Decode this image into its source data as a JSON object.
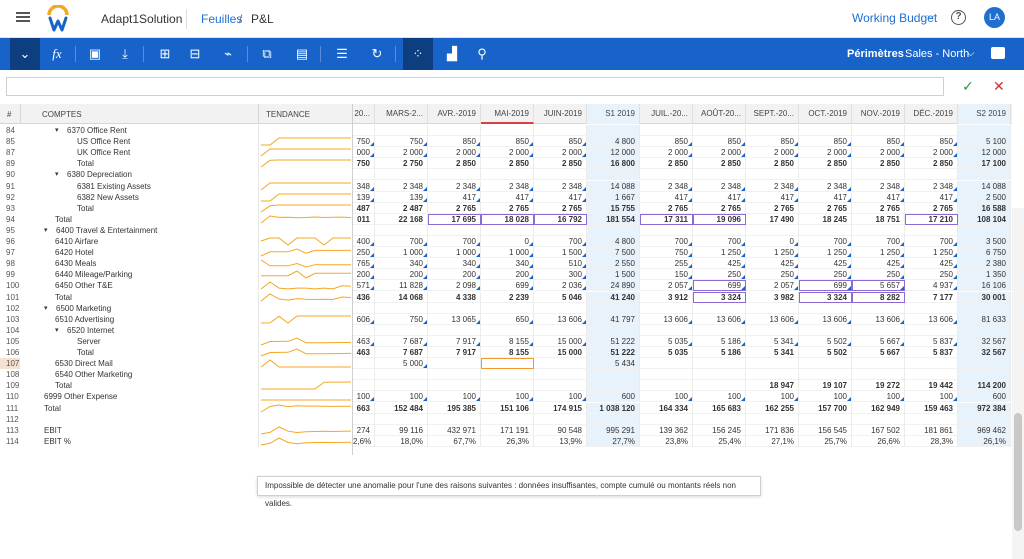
{
  "header": {
    "app_name": "Adapt1Solution",
    "breadcrumb": [
      "Feuilles",
      "/",
      "P&L"
    ],
    "working_budget": "Working Budget",
    "avatar_initials": "LA",
    "help": "?"
  },
  "toolbar": {
    "perimetres_label": "Périmètres",
    "sales_label": "Sales - North",
    "fx_label": "fx"
  },
  "formula": {
    "value": ""
  },
  "grid": {
    "hash": "#",
    "col_comptes": "COMPTES",
    "col_tendance": "TENDANCE",
    "columns": [
      "20...",
      "MARS-2...",
      "AVR.-2019",
      "MAI-2019",
      "JUIN-2019",
      "S1 2019",
      "JUIL.-20...",
      "AOÛT-20...",
      "SEPT.-20...",
      "OCT.-2019",
      "NOV.-2019",
      "DÉC.-2019",
      "S2 2019"
    ],
    "semester_columns": [
      5,
      12
    ],
    "current_column": 3,
    "rows": [
      {
        "n": "84",
        "label": "6370 Office Rent",
        "indent": 2,
        "exp": "▾",
        "v": [
          "",
          "",
          "",
          "",
          "",
          "",
          "",
          "",
          "",
          "",
          "",
          "",
          ""
        ]
      },
      {
        "n": "85",
        "label": "US Office Rent",
        "indent": 4,
        "v": [
          "750",
          "750",
          "850",
          "850",
          "850",
          "4 800",
          "850",
          "850",
          "850",
          "850",
          "850",
          "850",
          "5 100"
        ],
        "m": true
      },
      {
        "n": "87",
        "label": "UK Office Rent",
        "indent": 4,
        "v": [
          "000",
          "2 000",
          "2 000",
          "2 000",
          "2 000",
          "12 000",
          "2 000",
          "2 000",
          "2 000",
          "2 000",
          "2 000",
          "2 000",
          "12 000"
        ],
        "m": true
      },
      {
        "n": "89",
        "label": "Total",
        "indent": 4,
        "v": [
          "750",
          "2 750",
          "2 850",
          "2 850",
          "2 850",
          "16 800",
          "2 850",
          "2 850",
          "2 850",
          "2 850",
          "2 850",
          "2 850",
          "17 100"
        ],
        "b": true
      },
      {
        "n": "90",
        "label": "6380 Depreciation",
        "indent": 2,
        "exp": "▾",
        "v": [
          "",
          "",
          "",
          "",
          "",
          "",
          "",
          "",
          "",
          "",
          "",
          "",
          ""
        ]
      },
      {
        "n": "91",
        "label": "6381 Existing Assets",
        "indent": 4,
        "v": [
          "348",
          "2 348",
          "2 348",
          "2 348",
          "2 348",
          "14 088",
          "2 348",
          "2 348",
          "2 348",
          "2 348",
          "2 348",
          "2 348",
          "14 088"
        ],
        "m": true
      },
      {
        "n": "92",
        "label": "6382 New Assets",
        "indent": 4,
        "v": [
          "139",
          "139",
          "417",
          "417",
          "417",
          "1 667",
          "417",
          "417",
          "417",
          "417",
          "417",
          "417",
          "2 500"
        ],
        "m": true
      },
      {
        "n": "93",
        "label": "Total",
        "indent": 4,
        "v": [
          "487",
          "2 487",
          "2 765",
          "2 765",
          "2 765",
          "15 755",
          "2 765",
          "2 765",
          "2 765",
          "2 765",
          "2 765",
          "2 765",
          "16 588"
        ],
        "b": true
      },
      {
        "n": "94",
        "label": "Total",
        "indent": 2,
        "v": [
          "011",
          "22 168",
          "17 695",
          "18 028",
          "16 792",
          "181 554",
          "17 311",
          "19 096",
          "17 490",
          "18 245",
          "18 751",
          "17 210",
          "108 104"
        ],
        "b": true,
        "hl": [
          2,
          3,
          4,
          6,
          7,
          11
        ]
      },
      {
        "n": "95",
        "label": "6400 Travel & Entertainment",
        "indent": 1,
        "exp": "▾",
        "v": [
          "",
          "",
          "",
          "",
          "",
          "",
          "",
          "",
          "",
          "",
          "",
          "",
          ""
        ]
      },
      {
        "n": "96",
        "label": "6410 Airfare",
        "indent": 2,
        "v": [
          "400",
          "700",
          "700",
          "0",
          "700",
          "4 800",
          "700",
          "700",
          "0",
          "700",
          "700",
          "700",
          "3 500"
        ],
        "m": true
      },
      {
        "n": "97",
        "label": "6420 Hotel",
        "indent": 2,
        "v": [
          "250",
          "1 000",
          "1 000",
          "1 000",
          "1 500",
          "7 500",
          "750",
          "1 250",
          "1 250",
          "1 250",
          "1 250",
          "1 250",
          "6 750"
        ],
        "m": true
      },
      {
        "n": "98",
        "label": "6430 Meals",
        "indent": 2,
        "v": [
          "765",
          "340",
          "340",
          "340",
          "510",
          "2 550",
          "255",
          "425",
          "425",
          "425",
          "425",
          "425",
          "2 380"
        ],
        "m": true
      },
      {
        "n": "99",
        "label": "6440 Mileage/Parking",
        "indent": 2,
        "v": [
          "200",
          "200",
          "200",
          "200",
          "300",
          "1 500",
          "150",
          "250",
          "250",
          "250",
          "250",
          "250",
          "1 350"
        ],
        "m": true
      },
      {
        "n": "100",
        "label": "6450 Other T&E",
        "indent": 2,
        "v": [
          "571",
          "11 828",
          "2 098",
          "699",
          "2 036",
          "24 890",
          "2 057",
          "699",
          "2 057",
          "699",
          "5 657",
          "4 937",
          "16 106"
        ],
        "m": true,
        "hl": [
          7,
          9,
          10
        ]
      },
      {
        "n": "101",
        "label": "Total",
        "indent": 2,
        "v": [
          "436",
          "14 068",
          "4 338",
          "2 239",
          "5 046",
          "41 240",
          "3 912",
          "3 324",
          "3 982",
          "3 324",
          "8 282",
          "7 177",
          "30 001"
        ],
        "b": true,
        "hl": [
          7,
          9,
          10
        ]
      },
      {
        "n": "102",
        "label": "6500 Marketing",
        "indent": 1,
        "exp": "▾",
        "v": [
          "",
          "",
          "",
          "",
          "",
          "",
          "",
          "",
          "",
          "",
          "",
          "",
          ""
        ]
      },
      {
        "n": "103",
        "label": "6510 Advertising",
        "indent": 2,
        "v": [
          "606",
          "750",
          "13 065",
          "650",
          "13 606",
          "41 797",
          "13 606",
          "13 606",
          "13 606",
          "13 606",
          "13 606",
          "13 606",
          "81 633"
        ],
        "m": true
      },
      {
        "n": "104",
        "label": "6520 Internet",
        "indent": 2,
        "exp": "▾",
        "v": [
          "",
          "",
          "",
          "",
          "",
          "",
          "",
          "",
          "",
          "",
          "",
          "",
          ""
        ]
      },
      {
        "n": "105",
        "label": "Server",
        "indent": 4,
        "v": [
          "463",
          "7 687",
          "7 917",
          "8 155",
          "15 000",
          "51 222",
          "5 035",
          "5 186",
          "5 341",
          "5 502",
          "5 667",
          "5 837",
          "32 567"
        ],
        "m": true
      },
      {
        "n": "106",
        "label": "Total",
        "indent": 4,
        "v": [
          "463",
          "7 687",
          "7 917",
          "8 155",
          "15 000",
          "51 222",
          "5 035",
          "5 186",
          "5 341",
          "5 502",
          "5 667",
          "5 837",
          "32 567"
        ],
        "b": true
      },
      {
        "n": "107",
        "label": "6530 Direct Mail",
        "indent": 2,
        "v": [
          "",
          "5 000",
          "",
          "",
          "",
          "5 434",
          "",
          "",
          "",
          "",
          "",
          "",
          ""
        ],
        "m": true,
        "sel": [
          3
        ]
      },
      {
        "n": "108",
        "label": "6540 Other Marketing",
        "indent": 2,
        "v": [
          "",
          "",
          "",
          "",
          "",
          "",
          "",
          "",
          "",
          "",
          "",
          "",
          ""
        ]
      },
      {
        "n": "109",
        "label": "Total",
        "indent": 2,
        "v": [
          "",
          "",
          "",
          "",
          "",
          "",
          "",
          "",
          "18 947",
          "19 107",
          "19 272",
          "19 442",
          "114 200"
        ],
        "b": true
      },
      {
        "n": "110",
        "label": "6999 Other Expense",
        "indent": 1,
        "v": [
          "100",
          "100",
          "100",
          "100",
          "100",
          "600",
          "100",
          "100",
          "100",
          "100",
          "100",
          "100",
          "600"
        ],
        "m": true
      },
      {
        "n": "111",
        "label": "Total",
        "indent": 1,
        "v": [
          "663",
          "152 484",
          "195 385",
          "151 106",
          "174 915",
          "1 038 120",
          "164 334",
          "165 683",
          "162 255",
          "157 700",
          "162 949",
          "159 463",
          "972 384"
        ],
        "b": true
      },
      {
        "n": "112",
        "label": "",
        "indent": 0,
        "v": [
          "",
          "",
          "",
          "",
          "",
          "",
          "",
          "",
          "",
          "",
          "",
          "",
          ""
        ]
      },
      {
        "n": "113",
        "label": "EBIT",
        "indent": 1,
        "v": [
          "274",
          "99 116",
          "432 971",
          "171 191",
          "90 548",
          "995 291",
          "139 362",
          "156 245",
          "171 836",
          "156 545",
          "167 502",
          "181 861",
          "969 462"
        ]
      },
      {
        "n": "114",
        "label": "EBIT %",
        "indent": 1,
        "v": [
          "2,6%",
          "18,0%",
          "67,7%",
          "26,3%",
          "13,9%",
          "27,7%",
          "23,8%",
          "25,4%",
          "27,1%",
          "25,7%",
          "26,6%",
          "28,3%",
          "26,1%"
        ]
      }
    ]
  },
  "tooltip": {
    "text": "Impossible de détecter une anomalie pour l'une des raisons suivantes : données insuffisantes, compte cumulé ou montants réels non valides."
  },
  "colors": {
    "accent": "#1763c9",
    "highlight": "#8a6bd6",
    "selected": "#f09a2a",
    "semester_bg": "#e8f2fb",
    "sparkline": "#f5a623"
  }
}
